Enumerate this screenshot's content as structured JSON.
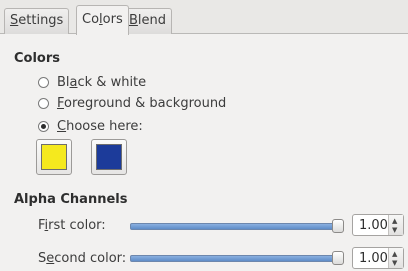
{
  "tabs": [
    {
      "label_pre": "",
      "label_u": "S",
      "label_post": "ettings"
    },
    {
      "label_pre": "Co",
      "label_u": "l",
      "label_post": "ors"
    },
    {
      "label_pre": "",
      "label_u": "B",
      "label_post": "lend"
    }
  ],
  "active_tab": "Colors",
  "colors": {
    "heading": "Colors",
    "options": [
      {
        "pre": "Bl",
        "u": "a",
        "post": "ck & white",
        "checked": false
      },
      {
        "pre": "",
        "u": "F",
        "post": "oreground & background",
        "checked": false
      },
      {
        "pre": "",
        "u": "C",
        "post": "hoose here:",
        "checked": true
      }
    ],
    "swatch_1": "#f5e91e",
    "swatch_2": "#1c3b9a"
  },
  "alpha": {
    "heading": "Alpha Channels",
    "first": {
      "pre": "F",
      "u": "i",
      "post": "rst color:",
      "value": "1.00",
      "level": 1.0
    },
    "second": {
      "pre": "S",
      "u": "e",
      "post": "cond color:",
      "value": "1.00",
      "level": 1.0
    }
  },
  "icons": {
    "spin_up": "chevron-up-icon",
    "spin_down": "chevron-down-icon"
  }
}
